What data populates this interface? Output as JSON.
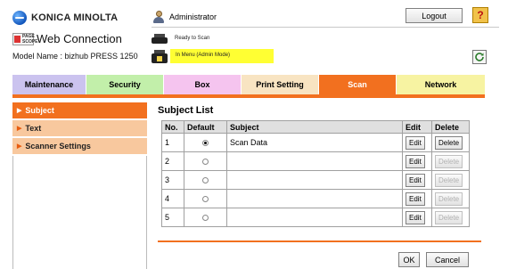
{
  "brand": {
    "company": "KONICA MINOLTA",
    "product": "Web Connection",
    "ps_line1": "PAGE",
    "ps_line2": "SCOPE"
  },
  "device": {
    "model": "Model Name : bizhub PRESS 1250"
  },
  "user": {
    "role": "Administrator"
  },
  "header": {
    "logout_label": "Logout",
    "help_label": "?"
  },
  "status": {
    "ready": "Ready to Scan",
    "mode": "In Menu (Admin Mode)"
  },
  "tabs": [
    {
      "label": "Maintenance"
    },
    {
      "label": "Security"
    },
    {
      "label": "Box"
    },
    {
      "label": "Print Setting"
    },
    {
      "label": "Scan",
      "active": true
    },
    {
      "label": "Network"
    }
  ],
  "sidebar": {
    "items": [
      {
        "label": "Subject",
        "active": true
      },
      {
        "label": "Text"
      },
      {
        "label": "Scanner Settings"
      }
    ]
  },
  "main": {
    "title": "Subject List",
    "columns": [
      "No.",
      "Default",
      "Subject",
      "Edit",
      "Delete"
    ],
    "rows": [
      {
        "no": "1",
        "selected": true,
        "subject": "Scan Data",
        "edit": "Edit",
        "delete": "Delete",
        "delete_enabled": true
      },
      {
        "no": "2",
        "selected": false,
        "subject": "",
        "edit": "Edit",
        "delete": "Delete",
        "delete_enabled": false
      },
      {
        "no": "3",
        "selected": false,
        "subject": "",
        "edit": "Edit",
        "delete": "Delete",
        "delete_enabled": false
      },
      {
        "no": "4",
        "selected": false,
        "subject": "",
        "edit": "Edit",
        "delete": "Delete",
        "delete_enabled": false
      },
      {
        "no": "5",
        "selected": false,
        "subject": "",
        "edit": "Edit",
        "delete": "Delete",
        "delete_enabled": false
      }
    ]
  },
  "footer": {
    "ok_label": "OK",
    "cancel_label": "Cancel"
  },
  "colors": {
    "accent": "#f2701f",
    "status_highlight": "#ffff33"
  }
}
